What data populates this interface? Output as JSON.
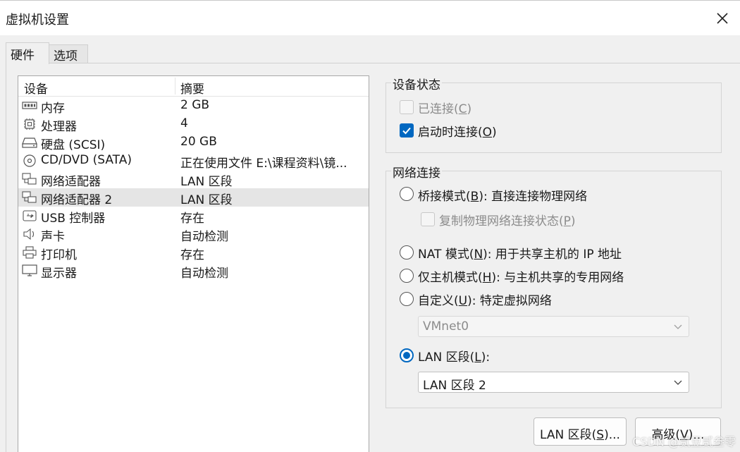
{
  "window": {
    "title": "虚拟机设置"
  },
  "tabs": [
    {
      "label": "硬件"
    },
    {
      "label": "选项"
    }
  ],
  "device_list": {
    "columns": {
      "device": "设备",
      "summary": "摘要"
    },
    "rows": [
      {
        "icon": "memory-icon",
        "device": "内存",
        "summary": "2 GB"
      },
      {
        "icon": "processor-icon",
        "device": "处理器",
        "summary": "4"
      },
      {
        "icon": "hard-disk-icon",
        "device": "硬盘 (SCSI)",
        "summary": "20 GB"
      },
      {
        "icon": "cd-dvd-icon",
        "device": "CD/DVD (SATA)",
        "summary": "正在使用文件 E:\\课程资料\\镜..."
      },
      {
        "icon": "network-adapter-icon",
        "device": "网络适配器",
        "summary": "LAN 区段"
      },
      {
        "icon": "network-adapter-icon",
        "device": "网络适配器 2",
        "summary": "LAN 区段",
        "selected": true
      },
      {
        "icon": "usb-icon",
        "device": "USB 控制器",
        "summary": "存在"
      },
      {
        "icon": "sound-card-icon",
        "device": "声卡",
        "summary": "自动检测"
      },
      {
        "icon": "printer-icon",
        "device": "打印机",
        "summary": "存在"
      },
      {
        "icon": "display-icon",
        "device": "显示器",
        "summary": "自动检测"
      }
    ]
  },
  "device_status": {
    "title": "设备状态",
    "connected": {
      "label": "已连接(",
      "key": "C",
      "suffix": ")",
      "checked": false,
      "disabled": true
    },
    "connect_at_power_on": {
      "label": "启动时连接(",
      "key": "O",
      "suffix": ")",
      "checked": true,
      "disabled": false
    }
  },
  "network_connection": {
    "title": "网络连接",
    "bridged": {
      "label": "桥接模式(",
      "key": "B",
      "suffix": "): 直接连接物理网络",
      "selected": false
    },
    "replicate_state": {
      "label": "复制物理网络连接状态(",
      "key": "P",
      "suffix": ")",
      "checked": false,
      "disabled": true
    },
    "nat": {
      "label": "NAT 模式(",
      "key": "N",
      "suffix": "): 用于共享主机的 IP 地址",
      "selected": false
    },
    "host_only": {
      "label": "仅主机模式(",
      "key": "H",
      "suffix": "): 与主机共享的专用网络",
      "selected": false
    },
    "custom": {
      "label": "自定义(",
      "key": "U",
      "suffix": "): 特定虚拟网络",
      "selected": false
    },
    "custom_network_select": {
      "value": "VMnet0",
      "disabled": true
    },
    "lan_segment": {
      "label": "LAN 区段(",
      "key": "L",
      "suffix": "):",
      "selected": true
    },
    "lan_segment_select": {
      "value": "LAN 区段 2",
      "disabled": false
    }
  },
  "buttons": {
    "lan_segments": {
      "label": "LAN 区段(",
      "key": "S",
      "suffix": ")..."
    },
    "advanced": {
      "label": "高级(",
      "key": "V",
      "suffix": ")..."
    }
  },
  "watermark": "CSDN @贰豆贰叁零",
  "colors": {
    "accent": "#0067c0",
    "selected_row": "#e5e5e5",
    "window_bg": "#f0f0f0"
  }
}
